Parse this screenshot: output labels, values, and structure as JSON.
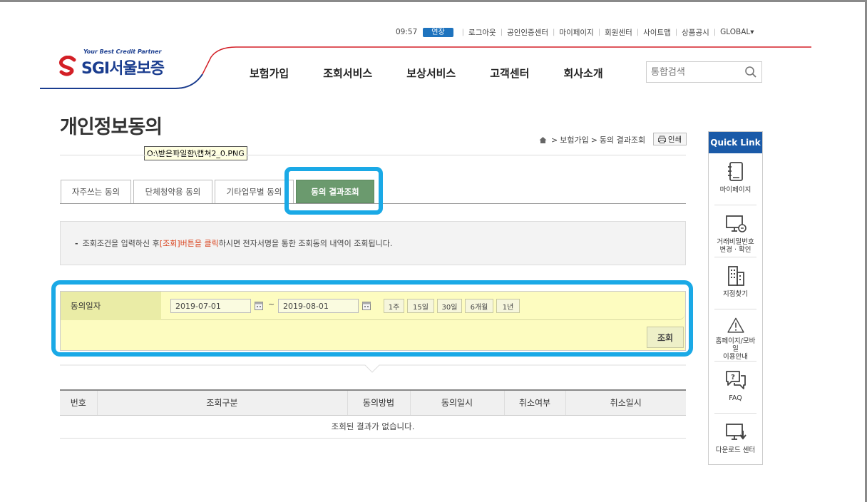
{
  "util": {
    "time": "09:57",
    "extend": "연장",
    "links": [
      "로그아웃",
      "공인인증센터",
      "마이페이지",
      "회원센터",
      "사이트맵",
      "상품공시",
      "GLOBAL▾"
    ]
  },
  "logo": {
    "tagline": "Your Best Credit Partner",
    "brand": "SGI서울보증"
  },
  "gnb": [
    "보험가입",
    "조회서비스",
    "보상서비스",
    "고객센터",
    "회사소개"
  ],
  "search": {
    "placeholder": "통합검색"
  },
  "page": {
    "title": "개인정보동의",
    "tooltip": "O:\\받은파일함\\캡쳐2_0.PNG"
  },
  "breadcrumb": {
    "level1": "보험가입",
    "level2": "동의 결과조회"
  },
  "print": "인쇄",
  "tabs": [
    "자주쓰는 동의",
    "단체청약용 동의",
    "기타업무별 동의",
    "동의 결과조회"
  ],
  "info": {
    "prefix": "조회조건을 입력하신 후 ",
    "highlight": "[조회]버튼을 클릭",
    "suffix": "하시면 전자서명을 통한 조회동의 내역이 조회됩니다."
  },
  "form": {
    "label": "동의일자",
    "from": "2019-07-01",
    "to": "2019-08-01",
    "tilde": "~",
    "periods": [
      "1주",
      "15일",
      "30일",
      "6개월",
      "1년"
    ],
    "query": "조회"
  },
  "table": {
    "headers": [
      "번호",
      "조회구분",
      "동의방법",
      "동의일시",
      "취소여부",
      "취소일시"
    ],
    "empty": "조회된 결과가 없습니다."
  },
  "quicklink": {
    "title": "Quick Link",
    "items": [
      {
        "label1": "마이페이지",
        "label2": ""
      },
      {
        "label1": "거래비밀번호",
        "label2": "변경 · 확인"
      },
      {
        "label1": "지점찾기",
        "label2": ""
      },
      {
        "label1": "홈페이지/모바일",
        "label2": "이용안내"
      },
      {
        "label1": "FAQ",
        "label2": ""
      },
      {
        "label1": "다운로드 센터",
        "label2": ""
      }
    ]
  },
  "colors": {
    "brand": "#1a3d8f",
    "accent_red": "#d9431e",
    "tab_active": "#6b9a6e",
    "highlight": "#1aa9e6",
    "form_bg": "#fdfcc0"
  }
}
